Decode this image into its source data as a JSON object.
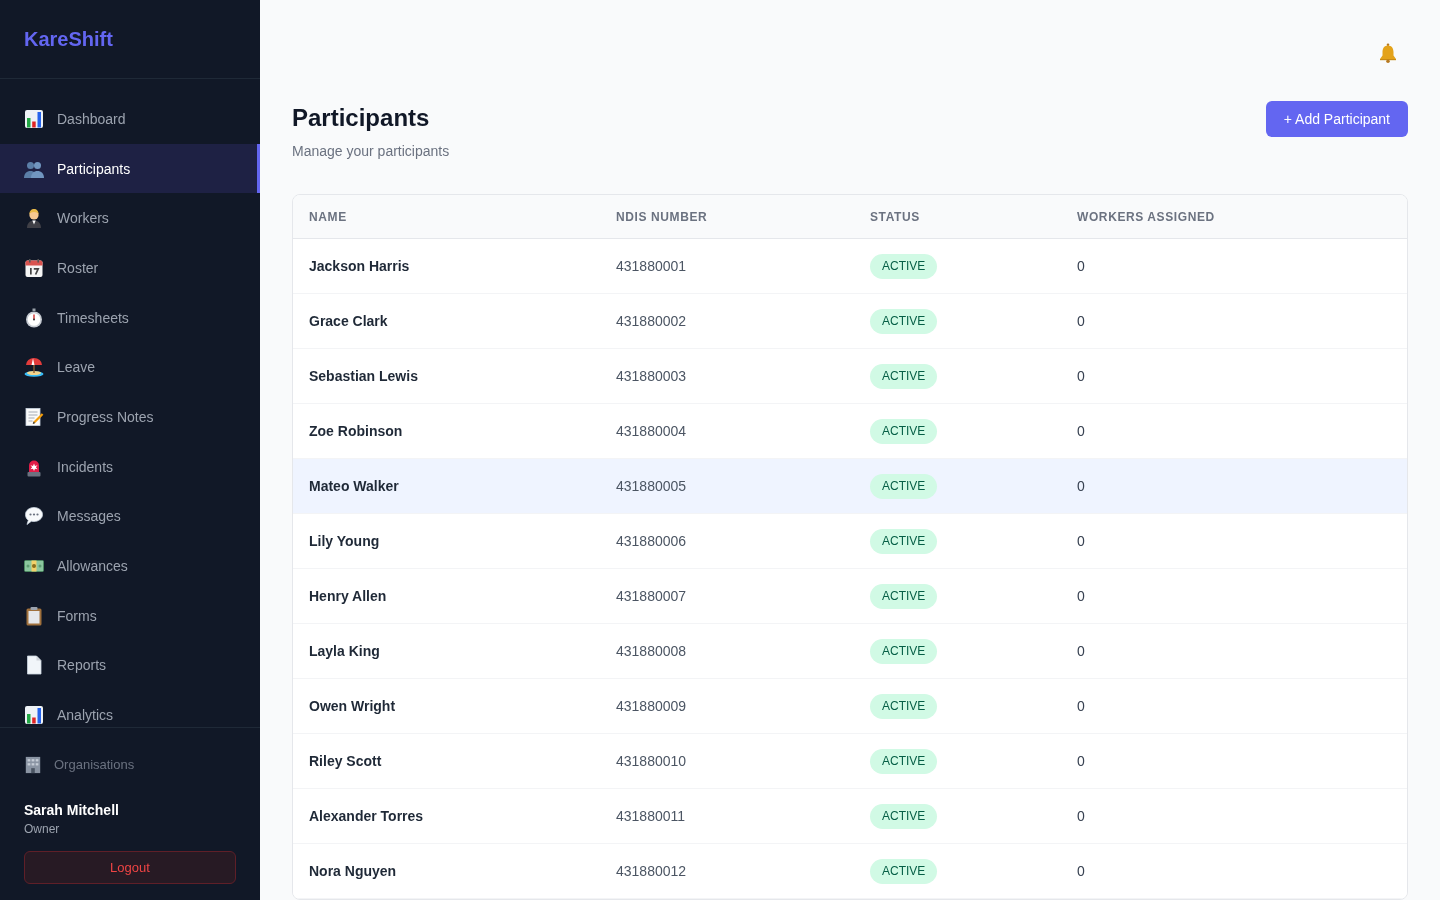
{
  "app": {
    "name": "KareShift"
  },
  "sidebar": {
    "items": [
      {
        "label": "Dashboard",
        "selected": false
      },
      {
        "label": "Participants",
        "selected": true
      },
      {
        "label": "Workers",
        "selected": false
      },
      {
        "label": "Roster",
        "selected": false
      },
      {
        "label": "Timesheets",
        "selected": false
      },
      {
        "label": "Leave",
        "selected": false
      },
      {
        "label": "Progress Notes",
        "selected": false
      },
      {
        "label": "Incidents",
        "selected": false
      },
      {
        "label": "Messages",
        "selected": false
      },
      {
        "label": "Allowances",
        "selected": false
      },
      {
        "label": "Forms",
        "selected": false
      },
      {
        "label": "Reports",
        "selected": false
      },
      {
        "label": "Analytics",
        "selected": false
      }
    ],
    "organisations_link": "Organisations",
    "user": {
      "name": "Sarah Mitchell",
      "role": "Owner"
    },
    "logout_button": "Logout"
  },
  "header": {
    "title": "Participants",
    "subtitle": "Manage your participants",
    "add_button": "+ Add Participant"
  },
  "table": {
    "columns": [
      "NAME",
      "NDIS NUMBER",
      "STATUS",
      "WORKERS ASSIGNED"
    ],
    "rows": [
      {
        "name": "Jackson Harris",
        "ndis_number": "431880001",
        "status": "ACTIVE",
        "workers_assigned": "0",
        "highlighted": false
      },
      {
        "name": "Grace Clark",
        "ndis_number": "431880002",
        "status": "ACTIVE",
        "workers_assigned": "0",
        "highlighted": false
      },
      {
        "name": "Sebastian Lewis",
        "ndis_number": "431880003",
        "status": "ACTIVE",
        "workers_assigned": "0",
        "highlighted": false
      },
      {
        "name": "Zoe Robinson",
        "ndis_number": "431880004",
        "status": "ACTIVE",
        "workers_assigned": "0",
        "highlighted": false
      },
      {
        "name": "Mateo Walker",
        "ndis_number": "431880005",
        "status": "ACTIVE",
        "workers_assigned": "0",
        "highlighted": true
      },
      {
        "name": "Lily Young",
        "ndis_number": "431880006",
        "status": "ACTIVE",
        "workers_assigned": "0",
        "highlighted": false
      },
      {
        "name": "Henry Allen",
        "ndis_number": "431880007",
        "status": "ACTIVE",
        "workers_assigned": "0",
        "highlighted": false
      },
      {
        "name": "Layla King",
        "ndis_number": "431880008",
        "status": "ACTIVE",
        "workers_assigned": "0",
        "highlighted": false
      },
      {
        "name": "Owen Wright",
        "ndis_number": "431880009",
        "status": "ACTIVE",
        "workers_assigned": "0",
        "highlighted": false
      },
      {
        "name": "Riley Scott",
        "ndis_number": "431880010",
        "status": "ACTIVE",
        "workers_assigned": "0",
        "highlighted": false
      },
      {
        "name": "Alexander Torres",
        "ndis_number": "431880011",
        "status": "ACTIVE",
        "workers_assigned": "0",
        "highlighted": false
      },
      {
        "name": "Nora Nguyen",
        "ndis_number": "431880012",
        "status": "ACTIVE",
        "workers_assigned": "0",
        "highlighted": false
      }
    ]
  }
}
